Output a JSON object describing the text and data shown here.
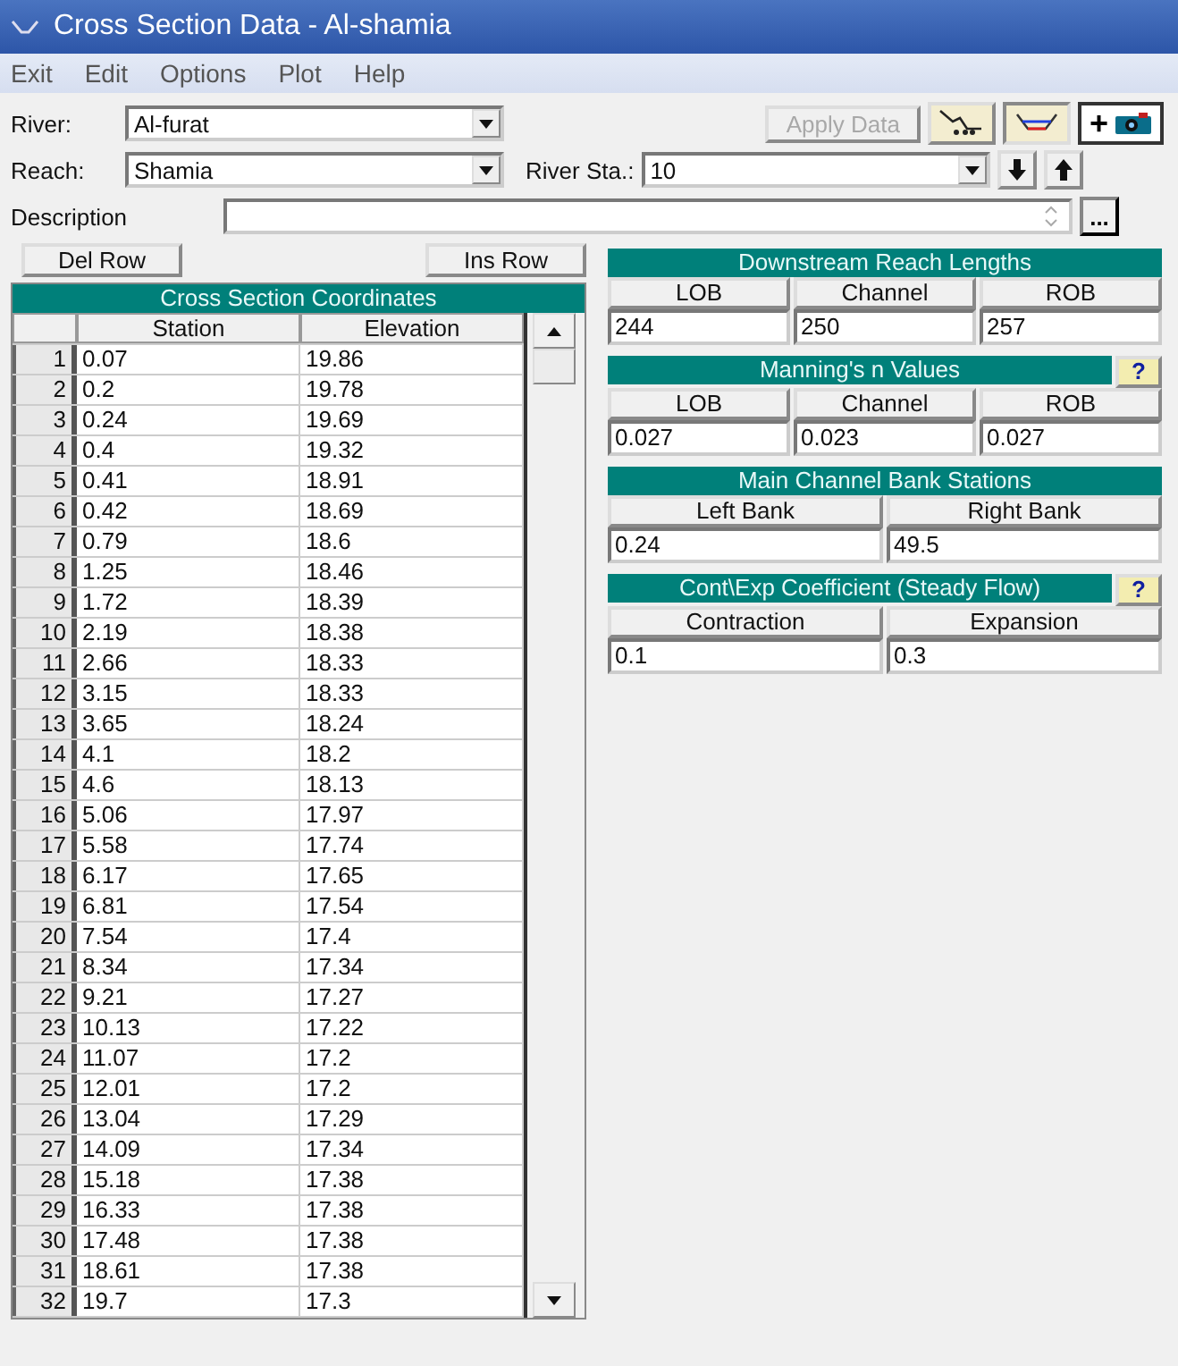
{
  "window": {
    "title": "Cross Section Data - Al-shamia"
  },
  "menu": [
    "Exit",
    "Edit",
    "Options",
    "Plot",
    "Help"
  ],
  "river": {
    "label": "River:",
    "value": "Al-furat"
  },
  "reach": {
    "label": "Reach:",
    "value": "Shamia"
  },
  "river_station": {
    "label": "River Sta.:",
    "value": "10"
  },
  "description": {
    "label": "Description"
  },
  "apply_button": {
    "label": "Apply Data",
    "disabled": true
  },
  "plot_button": {
    "label": "+"
  },
  "more_button": {
    "label": "..."
  },
  "row_buttons": [
    "Del Row",
    "Ins Row"
  ],
  "coordinates": {
    "title": "Cross Section Coordinates",
    "columns": [
      "Station",
      "Elevation"
    ],
    "rows": [
      {
        "index": "1",
        "station": "0.07",
        "elevation": "19.86"
      },
      {
        "index": "2",
        "station": "0.2",
        "elevation": "19.78"
      },
      {
        "index": "3",
        "station": "0.24",
        "elevation": "19.69"
      },
      {
        "index": "4",
        "station": "0.4",
        "elevation": "19.32"
      },
      {
        "index": "5",
        "station": "0.41",
        "elevation": "18.91"
      },
      {
        "index": "6",
        "station": "0.42",
        "elevation": "18.69"
      },
      {
        "index": "7",
        "station": "0.79",
        "elevation": "18.6"
      },
      {
        "index": "8",
        "station": "1.25",
        "elevation": "18.46"
      },
      {
        "index": "9",
        "station": "1.72",
        "elevation": "18.39"
      },
      {
        "index": "10",
        "station": "2.19",
        "elevation": "18.38"
      },
      {
        "index": "11",
        "station": "2.66",
        "elevation": "18.33"
      },
      {
        "index": "12",
        "station": "3.15",
        "elevation": "18.33"
      },
      {
        "index": "13",
        "station": "3.65",
        "elevation": "18.24"
      },
      {
        "index": "14",
        "station": "4.1",
        "elevation": "18.2"
      },
      {
        "index": "15",
        "station": "4.6",
        "elevation": "18.13"
      },
      {
        "index": "16",
        "station": "5.06",
        "elevation": "17.97"
      },
      {
        "index": "17",
        "station": "5.58",
        "elevation": "17.74"
      },
      {
        "index": "18",
        "station": "6.17",
        "elevation": "17.65"
      },
      {
        "index": "19",
        "station": "6.81",
        "elevation": "17.54"
      },
      {
        "index": "20",
        "station": "7.54",
        "elevation": "17.4"
      },
      {
        "index": "21",
        "station": "8.34",
        "elevation": "17.34"
      },
      {
        "index": "22",
        "station": "9.21",
        "elevation": "17.27"
      },
      {
        "index": "23",
        "station": "10.13",
        "elevation": "17.22"
      },
      {
        "index": "24",
        "station": "11.07",
        "elevation": "17.2"
      },
      {
        "index": "25",
        "station": "12.01",
        "elevation": "17.2"
      },
      {
        "index": "26",
        "station": "13.04",
        "elevation": "17.29"
      },
      {
        "index": "27",
        "station": "14.09",
        "elevation": "17.34"
      },
      {
        "index": "28",
        "station": "15.18",
        "elevation": "17.38"
      },
      {
        "index": "29",
        "station": "16.33",
        "elevation": "17.38"
      },
      {
        "index": "30",
        "station": "17.48",
        "elevation": "17.38"
      },
      {
        "index": "31",
        "station": "18.61",
        "elevation": "17.38"
      },
      {
        "index": "32",
        "station": "19.7",
        "elevation": "17.3"
      }
    ]
  },
  "panels": [
    {
      "title": "Downstream Reach Lengths",
      "columns": [
        "LOB",
        "Channel",
        "ROB"
      ],
      "values": [
        "244",
        "250",
        "257"
      ]
    },
    {
      "title": "Manning's n Values",
      "help": "?",
      "columns": [
        "LOB",
        "Channel",
        "ROB"
      ],
      "values": [
        "0.027",
        "0.023",
        "0.027"
      ]
    },
    {
      "title": "Main Channel Bank Stations",
      "columns": [
        "Left Bank",
        "Right Bank"
      ],
      "values": [
        "0.24",
        "49.5"
      ]
    },
    {
      "title": "Cont\\Exp Coefficient (Steady Flow)",
      "help": "?",
      "columns": [
        "Contraction",
        "Expansion"
      ],
      "values": [
        "0.1",
        "0.3"
      ]
    }
  ]
}
